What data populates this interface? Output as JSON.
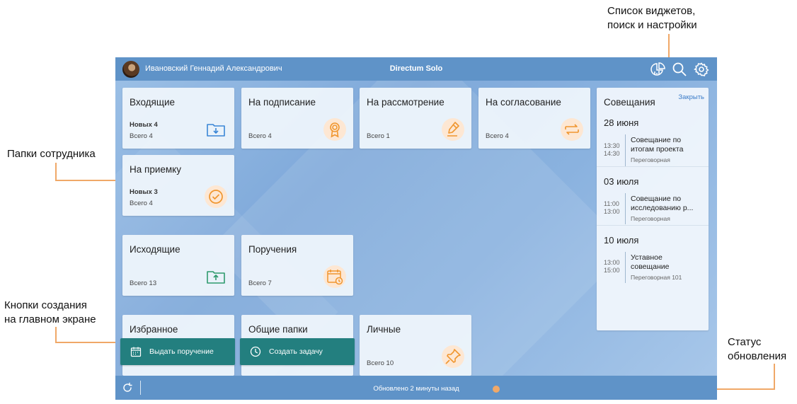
{
  "callouts": {
    "widgets": [
      "Список виджетов,",
      "поиск и настройки"
    ],
    "folders": "Папки сотрудника",
    "buttons": [
      "Кнопки создания",
      "на главном экране"
    ],
    "status": [
      "Статус",
      "обновления"
    ]
  },
  "header": {
    "user_name": "Ивановский Геннадий Александрович",
    "app_title": "Directum Solo",
    "icons": [
      "widgets-icon",
      "search-icon",
      "settings-icon"
    ]
  },
  "tiles": [
    {
      "title": "Входящие",
      "new": "Новых 4",
      "total": "Всего 4",
      "icon": "folder-download-icon"
    },
    {
      "title": "На подписание",
      "new": "",
      "total": "Всего 4",
      "icon": "award-icon"
    },
    {
      "title": "На рассмотрение",
      "new": "",
      "total": "Всего 1",
      "icon": "pen-icon"
    },
    {
      "title": "На согласование",
      "new": "",
      "total": "Всего 4",
      "icon": "exchange-icon"
    },
    {
      "title": "На приемку",
      "new": "Новых 3",
      "total": "Всего 4",
      "icon": "check-circle-icon"
    },
    {
      "title": "Исходящие",
      "new": "",
      "total": "Всего 13",
      "icon": "folder-upload-icon"
    },
    {
      "title": "Поручения",
      "new": "",
      "total": "Всего 7",
      "icon": "calendar-clock-icon"
    },
    {
      "title": "Избранное",
      "new": "",
      "total": "",
      "icon": ""
    },
    {
      "title": "Общие папки",
      "new": "",
      "total": "",
      "icon": ""
    },
    {
      "title": "Личные",
      "new": "",
      "total": "Всего 10",
      "icon": "pin-icon"
    }
  ],
  "meetings": {
    "title": "Совещания",
    "close_label": "Закрыть",
    "days": [
      {
        "date": "28 июня",
        "start": "13:30",
        "end": "14:30",
        "title": [
          "Совещание по",
          "итогам проекта"
        ],
        "room": "Переговорная"
      },
      {
        "date": "03 июля",
        "start": "11:00",
        "end": "13:00",
        "title": [
          "Совещание по",
          "исследованию р..."
        ],
        "room": "Переговорная"
      },
      {
        "date": "10 июля",
        "start": "13:00",
        "end": "15:00",
        "title": [
          "Уставное",
          "совещание"
        ],
        "room": "Переговорная 101"
      }
    ]
  },
  "actions": {
    "assign_label": "Выдать поручение",
    "task_label": "Создать задачу"
  },
  "status": {
    "text": "Обновлено 2 минуты назад"
  },
  "colors": {
    "accent": "#f0a868",
    "header": "#5f93c8",
    "action": "#237f7f",
    "icon_blue": "#3a86d6",
    "icon_orange": "#f0962f",
    "icon_green": "#2e9a6d"
  }
}
